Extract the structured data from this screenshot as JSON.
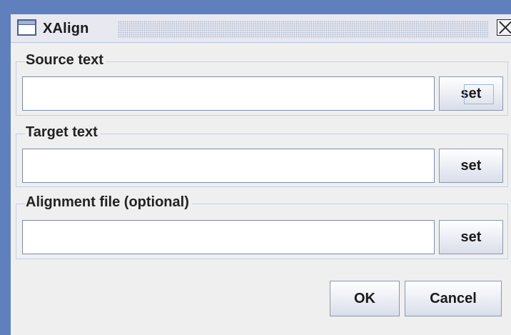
{
  "window": {
    "title": "XAlign"
  },
  "source": {
    "label": "Source text",
    "value": "",
    "button_label": "set"
  },
  "target": {
    "label": "Target text",
    "value": "",
    "button_label": "set"
  },
  "alignment": {
    "label": "Alignment file (optional)",
    "value": "",
    "button_label": "set"
  },
  "actions": {
    "ok_label": "OK",
    "cancel_label": "Cancel"
  },
  "colors": {
    "window_frame": "#5f7fbd",
    "panel_background": "#efefef",
    "group_border": "#c3cfe6"
  },
  "icons": {
    "window_icon": "window-icon",
    "close_icon": "close-icon"
  }
}
